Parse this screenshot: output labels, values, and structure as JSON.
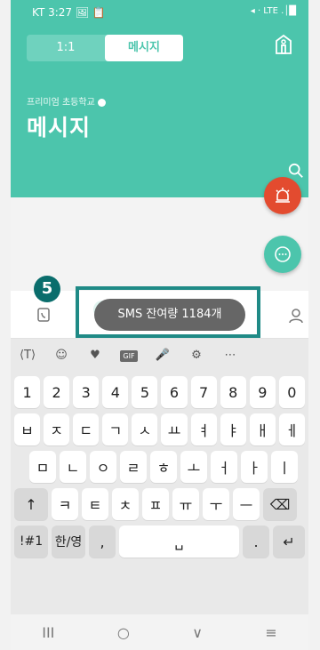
{
  "status_bar": {
    "left": "KT 3:27 🖼 📋",
    "right": "◂ · LTE .│█"
  },
  "header": {
    "tabs": [
      {
        "label": "1:1"
      },
      {
        "label": "메시지"
      }
    ],
    "school": "프리미엄 초등학교",
    "title": "메시지"
  },
  "overlay": {
    "badge": "5",
    "toast": "SMS 잔여량 1184개"
  },
  "keyboard": {
    "toolbar": [
      "⟨T⟩",
      "☺",
      "♥",
      "GIF",
      "🎤",
      "⚙",
      "⋯"
    ],
    "rows": [
      [
        "1",
        "2",
        "3",
        "4",
        "5",
        "6",
        "7",
        "8",
        "9",
        "0"
      ],
      [
        "ㅂ",
        "ㅈ",
        "ㄷ",
        "ㄱ",
        "ㅅ",
        "ㅛ",
        "ㅕ",
        "ㅑ",
        "ㅐ",
        "ㅔ"
      ],
      [
        "ㅁ",
        "ㄴ",
        "ㅇ",
        "ㄹ",
        "ㅎ",
        "ㅗ",
        "ㅓ",
        "ㅏ",
        "ㅣ"
      ],
      [
        "↑",
        "ㅋ",
        "ㅌ",
        "ㅊ",
        "ㅍ",
        "ㅠ",
        "ㅜ",
        "ㅡ",
        "⌫"
      ],
      [
        "!#1",
        "한/영",
        ",",
        "␣",
        ".",
        "↵"
      ]
    ]
  },
  "nav": [
    "III",
    "○",
    "∨",
    "≡"
  ],
  "colors": {
    "primary": "#4cc5ac",
    "alarm": "#e34b2f",
    "highlight": "#1f8a86",
    "badge": "#0a6d6c"
  }
}
